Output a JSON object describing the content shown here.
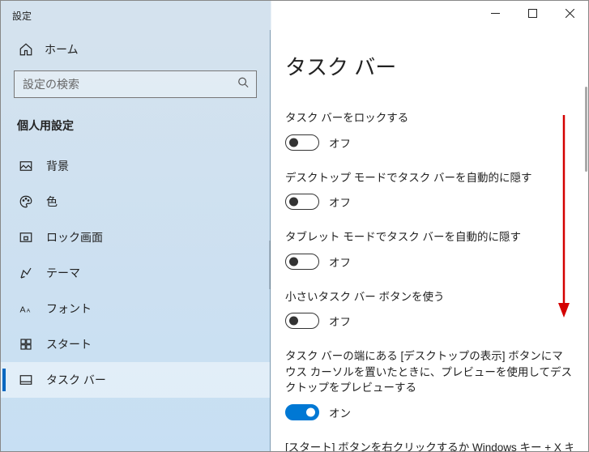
{
  "window": {
    "title": "設定"
  },
  "sidebar": {
    "home": "ホーム",
    "search_placeholder": "設定の検索",
    "section": "個人用設定",
    "items": [
      {
        "label": "背景"
      },
      {
        "label": "色"
      },
      {
        "label": "ロック画面"
      },
      {
        "label": "テーマ"
      },
      {
        "label": "フォント"
      },
      {
        "label": "スタート"
      },
      {
        "label": "タスク バー"
      }
    ]
  },
  "main": {
    "title": "タスク バー",
    "state_off": "オフ",
    "state_on": "オン",
    "settings": [
      {
        "label": "タスク バーをロックする",
        "on": false
      },
      {
        "label": "デスクトップ モードでタスク バーを自動的に隠す",
        "on": false
      },
      {
        "label": "タブレット モードでタスク バーを自動的に隠す",
        "on": false
      },
      {
        "label": "小さいタスク バー ボタンを使う",
        "on": false
      },
      {
        "label": "タスク バーの端にある [デスクトップの表示] ボタンにマウス カーソルを置いたときに、プレビューを使用してデスクトップをプレビューする",
        "on": true
      }
    ],
    "truncated": "[スタート] ボタンを右クリックするか Windows キー + X キ"
  }
}
